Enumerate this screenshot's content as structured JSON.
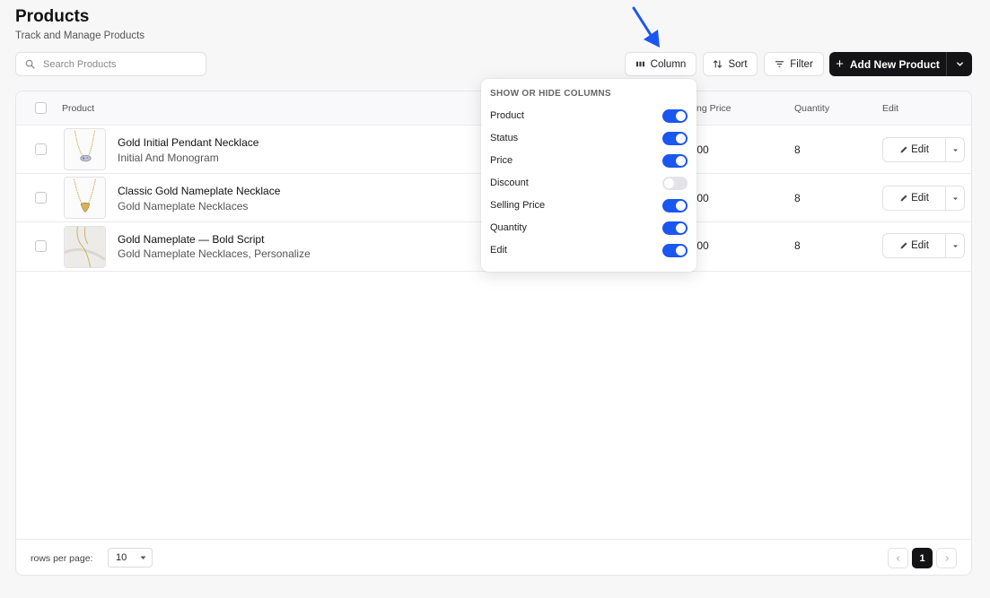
{
  "header": {
    "title": "Products",
    "subtitle": "Track and Manage Products"
  },
  "search": {
    "placeholder": "Search Products",
    "value": ""
  },
  "toolbar": {
    "column_label": "Column",
    "sort_label": "Sort",
    "filter_label": "Filter",
    "add_label": "Add New Product"
  },
  "table": {
    "headers": {
      "product": "Product",
      "selling_price": "ng Price",
      "quantity": "Quantity",
      "edit": "Edit"
    },
    "rows": [
      {
        "name": "Gold Initial Pendant Necklace",
        "category": "Initial And Monogram",
        "price": ".00",
        "quantity": "8",
        "edit_label": "Edit"
      },
      {
        "name": "Classic Gold Nameplate Necklace",
        "category": "Gold Nameplate Necklaces",
        "price": ".00",
        "quantity": "8",
        "edit_label": "Edit"
      },
      {
        "name": "Gold Nameplate — Bold Script",
        "category": "Gold Nameplate Necklaces, Personalize",
        "price": ".00",
        "quantity": "8",
        "edit_label": "Edit"
      }
    ]
  },
  "footer": {
    "rows_per_page_label": "rows per page:",
    "rows_per_page_value": "10",
    "current_page": "1"
  },
  "column_menu": {
    "title": "SHOW OR HIDE COLUMNS",
    "items": [
      {
        "label": "Product",
        "enabled": true
      },
      {
        "label": "Status",
        "enabled": true
      },
      {
        "label": "Price",
        "enabled": true
      },
      {
        "label": "Discount",
        "enabled": false
      },
      {
        "label": "Selling Price",
        "enabled": true
      },
      {
        "label": "Quantity",
        "enabled": true
      },
      {
        "label": "Edit",
        "enabled": true
      }
    ]
  },
  "colors": {
    "accent": "#1a56f0",
    "primary_button": "#141416",
    "annotation_arrow": "#1a56f0"
  }
}
